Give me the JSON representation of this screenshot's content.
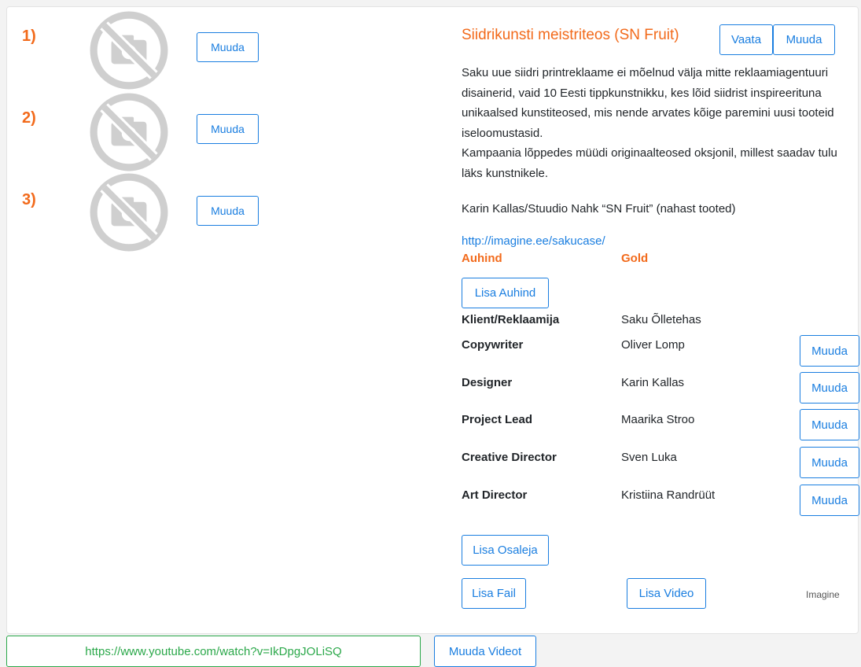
{
  "thumbs": [
    {
      "num": "1)",
      "edit": "Muuda"
    },
    {
      "num": "2)",
      "edit": "Muuda"
    },
    {
      "num": "3)",
      "edit": "Muuda"
    }
  ],
  "work": {
    "title": "Siidrikunsti meistriteos (SN Fruit)",
    "view_label": "Vaata",
    "edit_label": "Muuda",
    "description_1": "Saku uue siidri printreklaame ei mõelnud välja mitte reklaamiagentuuri disainerid, vaid 10 Eesti tippkunstnikku, kes lõid siidrist inspireerituna unikaalsed kunstiteosed, mis nende arvates kõige paremini uusi tooteid iseloomustasid.",
    "description_2": "Kampaania lõppedes müüdi originaalteosed oksjonil, millest saadav tulu läks kunstnikele.",
    "credit": "Karin Kallas/Stuudio Nahk “SN Fruit” (nahast tooted)",
    "link": "http://imagine.ee/sakucase/",
    "award_label": "Auhind",
    "award_value": "Gold",
    "add_award": "Lisa Auhind",
    "client_label": "Klient/Reklaamija",
    "client_value": "Saku Õlletehas",
    "participants": [
      {
        "role": "Copywriter",
        "name": "Oliver Lomp",
        "edit": "Muuda"
      },
      {
        "role": "Designer",
        "name": "Karin Kallas",
        "edit": "Muuda"
      },
      {
        "role": "Project Lead",
        "name": "Maarika Stroo",
        "edit": "Muuda"
      },
      {
        "role": "Creative Director",
        "name": "Sven Luka",
        "edit": "Muuda"
      },
      {
        "role": "Art Director",
        "name": "Kristiina Randrüüt",
        "edit": "Muuda"
      }
    ],
    "add_participant": "Lisa Osaleja",
    "add_file": "Lisa Fail",
    "add_video": "Lisa Video",
    "agency": "Imagine"
  },
  "video": {
    "url": "https://www.youtube.com/watch?v=IkDpgJOLiSQ",
    "edit_videos": "Muuda Videot"
  },
  "colors": {
    "accent": "#f26a1b",
    "link": "#1a7ee0",
    "video": "#2ba84a"
  },
  "icons": {
    "placeholder": "no-camera-icon"
  }
}
